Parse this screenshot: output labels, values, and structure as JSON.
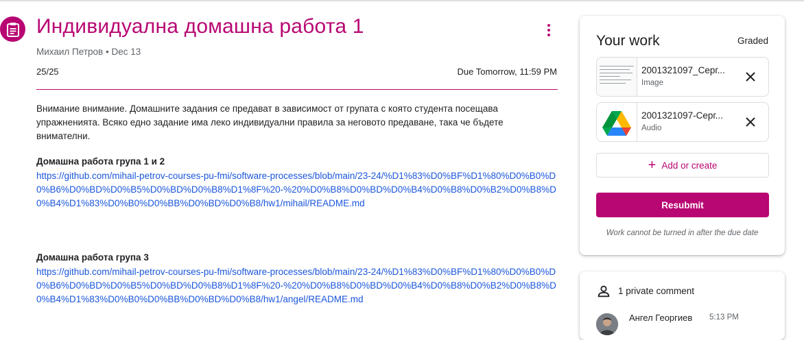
{
  "assignment": {
    "title": "Индивидуална домашна работа 1",
    "author": "Михаил Петров",
    "date": "Dec 13",
    "points": "25/25",
    "due": "Due Tomorrow, 11:59 PM",
    "instructions": "Внимание внимание. Домашните задания се предават в зависимост от групата с която студента посещава упражненията. Всяко едно задание има леко индивидуални правила за неговото предаване, така че бъдете внимателни.",
    "sections": [
      {
        "title": "Домашна работа група 1 и 2",
        "link": "https://github.com/mihail-petrov-courses-pu-fmi/software-processes/blob/main/23-24/%D1%83%D0%BF%D1%80%D0%B0%D0%B6%D0%BD%D0%B5%D0%BD%D0%B8%D1%8F%20-%20%D0%B8%D0%BD%D0%B4%D0%B8%D0%B2%D0%B8%D0%B4%D1%83%D0%B0%D0%BB%D0%BD%D0%B8/hw1/mihail/README.md"
      },
      {
        "title": "Домашна работа група 3",
        "link": "https://github.com/mihail-petrov-courses-pu-fmi/software-processes/blob/main/23-24/%D1%83%D0%BF%D1%80%D0%B0%D0%B6%D0%BD%D0%B5%D0%BD%D0%B8%D1%8F%20-%20%D0%B8%D0%BD%D0%B4%D0%B8%D0%B2%D0%B8%D0%B4%D1%83%D0%B0%D0%BB%D0%BD%D0%B8/hw1/angel/README.md"
      }
    ]
  },
  "your_work": {
    "title": "Your work",
    "status": "Graded",
    "files": [
      {
        "name": "2001321097_Серг...",
        "type": "Image",
        "icon": "image-thumbnail"
      },
      {
        "name": "2001321097-Серг...",
        "type": "Audio",
        "icon": "google-drive-icon"
      }
    ],
    "add_label": "Add or create",
    "resubmit_label": "Resubmit",
    "note": "Work cannot be turned in after the due date"
  },
  "comments": {
    "label": "1 private comment",
    "commenter": "Ангел Георгиев",
    "time": "5:13 PM"
  },
  "colors": {
    "accent": "#b80672",
    "link": "#1a56db"
  }
}
